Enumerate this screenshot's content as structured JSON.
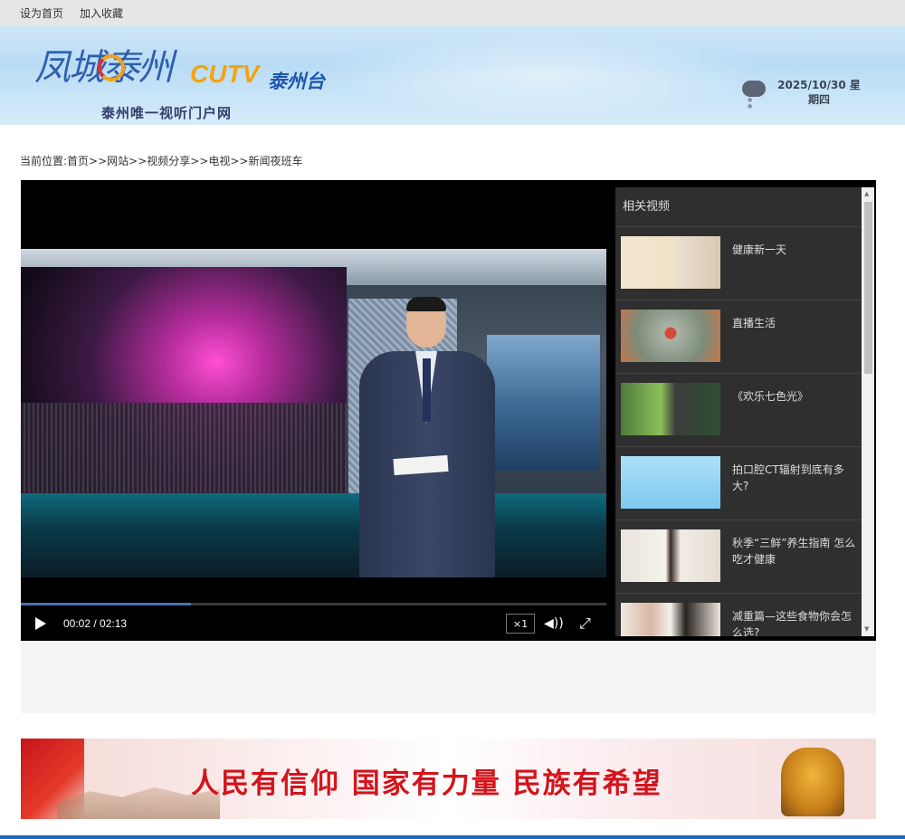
{
  "topbar": {
    "set_home": "设为首页",
    "add_favorite": "加入收藏"
  },
  "header": {
    "logo_brush": "凤城泰州",
    "logo_cutv": "CUTV",
    "logo_station": "泰州台",
    "logo_slogan": "泰州唯一视听门户网",
    "weather_icon": "cloud-rain-icon",
    "date": "2025/10/30 星期四"
  },
  "breadcrumb": "当前位置:首页>>网站>>视频分享>>电视>>新闻夜班车",
  "player": {
    "time": "00:02 / 02:13",
    "progress": 0.29,
    "rate": "×1",
    "play_icon": "play-icon",
    "volume_icon": "volume-icon",
    "fullscreen_icon": "fullscreen-icon"
  },
  "related": {
    "title": "相关视频",
    "items": [
      {
        "title": "健康新一天"
      },
      {
        "title": "直播生活"
      },
      {
        "title": "《欢乐七色光》"
      },
      {
        "title": "拍口腔CT辐射到底有多大?"
      },
      {
        "title": "秋季“三鲜”养生指南 怎么吃才健康"
      },
      {
        "title": "减重篇—这些食物你会怎么选?"
      }
    ]
  },
  "banner": {
    "slogan": "人民有信仰 国家有力量 民族有希望"
  },
  "colors": {
    "accent": "#1d68b8",
    "banner_red": "#d3141c"
  }
}
